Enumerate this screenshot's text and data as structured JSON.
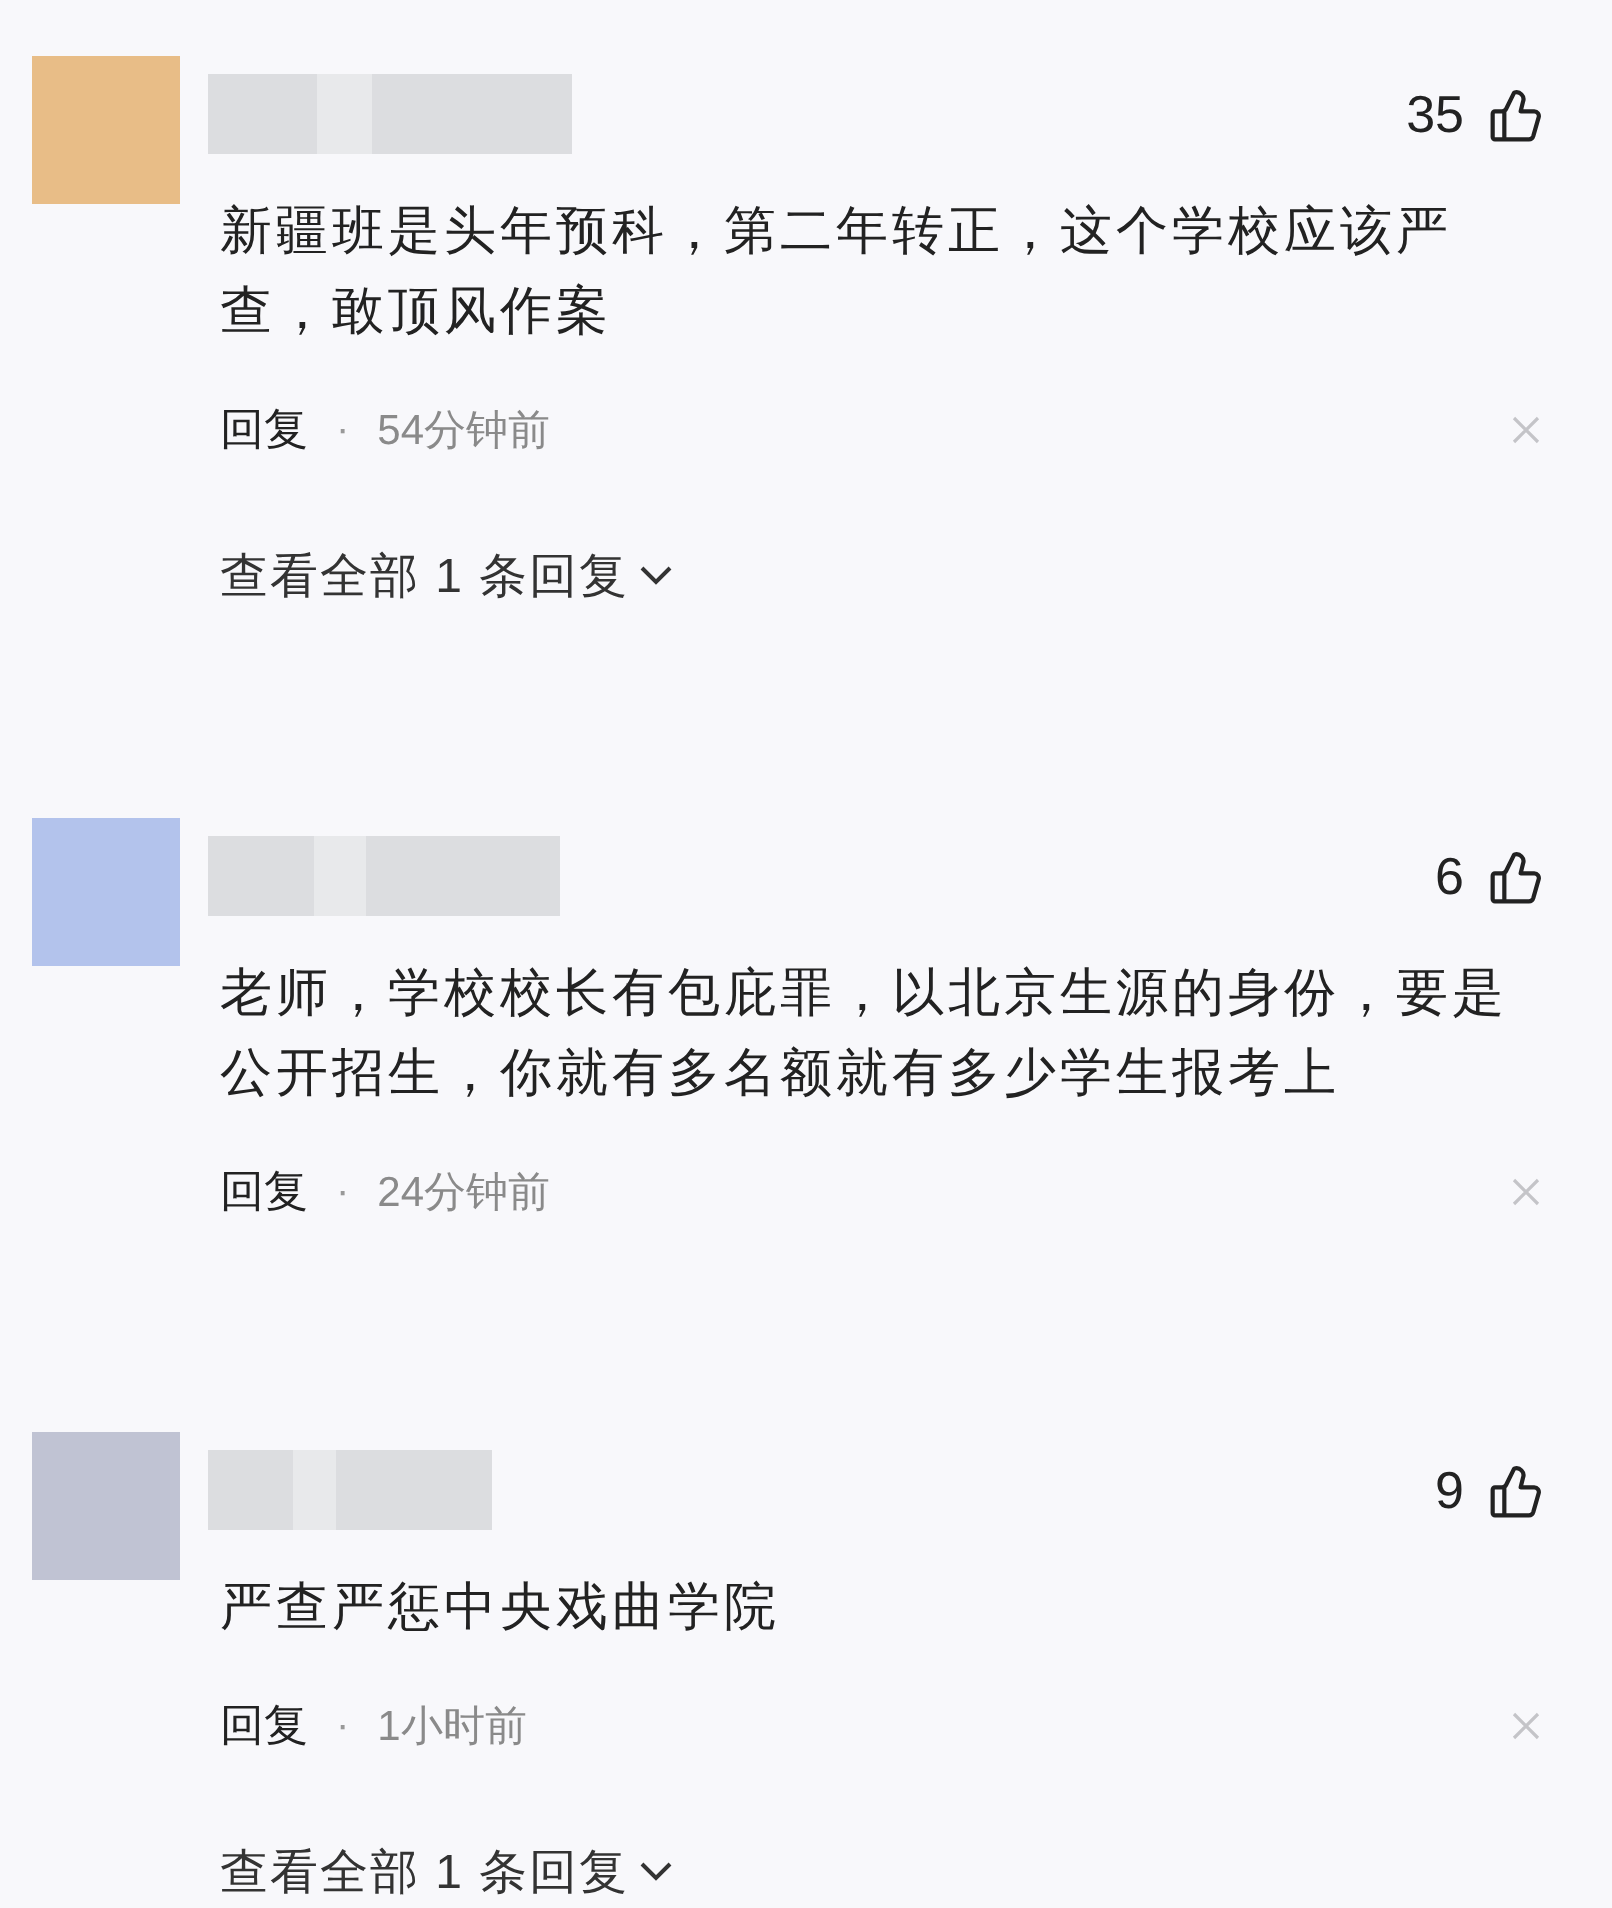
{
  "comments": [
    {
      "color": "#e8bd87",
      "likes": "35",
      "text": "新疆班是头年预科，第二年转正，这个学校应该严查，敢顶风作案",
      "reply": "回复",
      "separator": "·",
      "time": "54分钟前",
      "expand": "查看全部 1 条回复"
    },
    {
      "color": "#b3c3ec",
      "likes": "6",
      "text": "老师，学校校长有包庇罪，以北京生源的身份，要是公开招生，你就有多名额就有多少学生报考上",
      "reply": "回复",
      "separator": "·",
      "time": "24分钟前"
    },
    {
      "color": "#c0c3d3",
      "likes": "9",
      "text": "严查严惩中央戏曲学院",
      "reply": "回复",
      "separator": "·",
      "time": "1小时前",
      "expand": "查看全部 1 条回复"
    }
  ]
}
